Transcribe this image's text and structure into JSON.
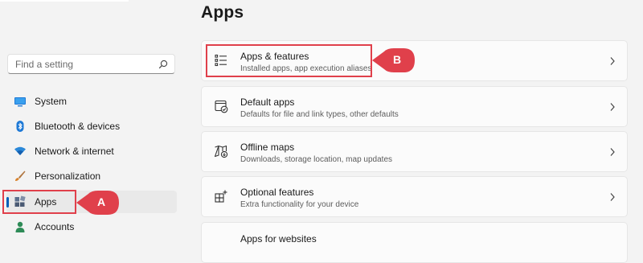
{
  "page": {
    "title": "Apps"
  },
  "search": {
    "placeholder": "Find a setting",
    "icon": "search-icon"
  },
  "sidebar": {
    "items": [
      {
        "label": "System",
        "icon": "monitor-icon"
      },
      {
        "label": "Bluetooth & devices",
        "icon": "bluetooth-icon"
      },
      {
        "label": "Network & internet",
        "icon": "wifi-icon"
      },
      {
        "label": "Personalization",
        "icon": "brush-icon"
      },
      {
        "label": "Apps",
        "icon": "apps-icon",
        "selected": true
      },
      {
        "label": "Accounts",
        "icon": "person-icon"
      }
    ]
  },
  "cards": [
    {
      "title": "Apps & features",
      "subtitle": "Installed apps, app execution aliases",
      "icon": "list-icon"
    },
    {
      "title": "Default apps",
      "subtitle": "Defaults for file and link types, other defaults",
      "icon": "default-apps-icon"
    },
    {
      "title": "Offline maps",
      "subtitle": "Downloads, storage location, map updates",
      "icon": "map-icon"
    },
    {
      "title": "Optional features",
      "subtitle": "Extra functionality for your device",
      "icon": "optional-features-icon"
    },
    {
      "title": "Apps for websites",
      "subtitle": "",
      "icon": ""
    }
  ],
  "annotations": {
    "a": "A",
    "b": "B"
  },
  "colors": {
    "highlight": "#e0404b",
    "accent": "#005fb8"
  }
}
